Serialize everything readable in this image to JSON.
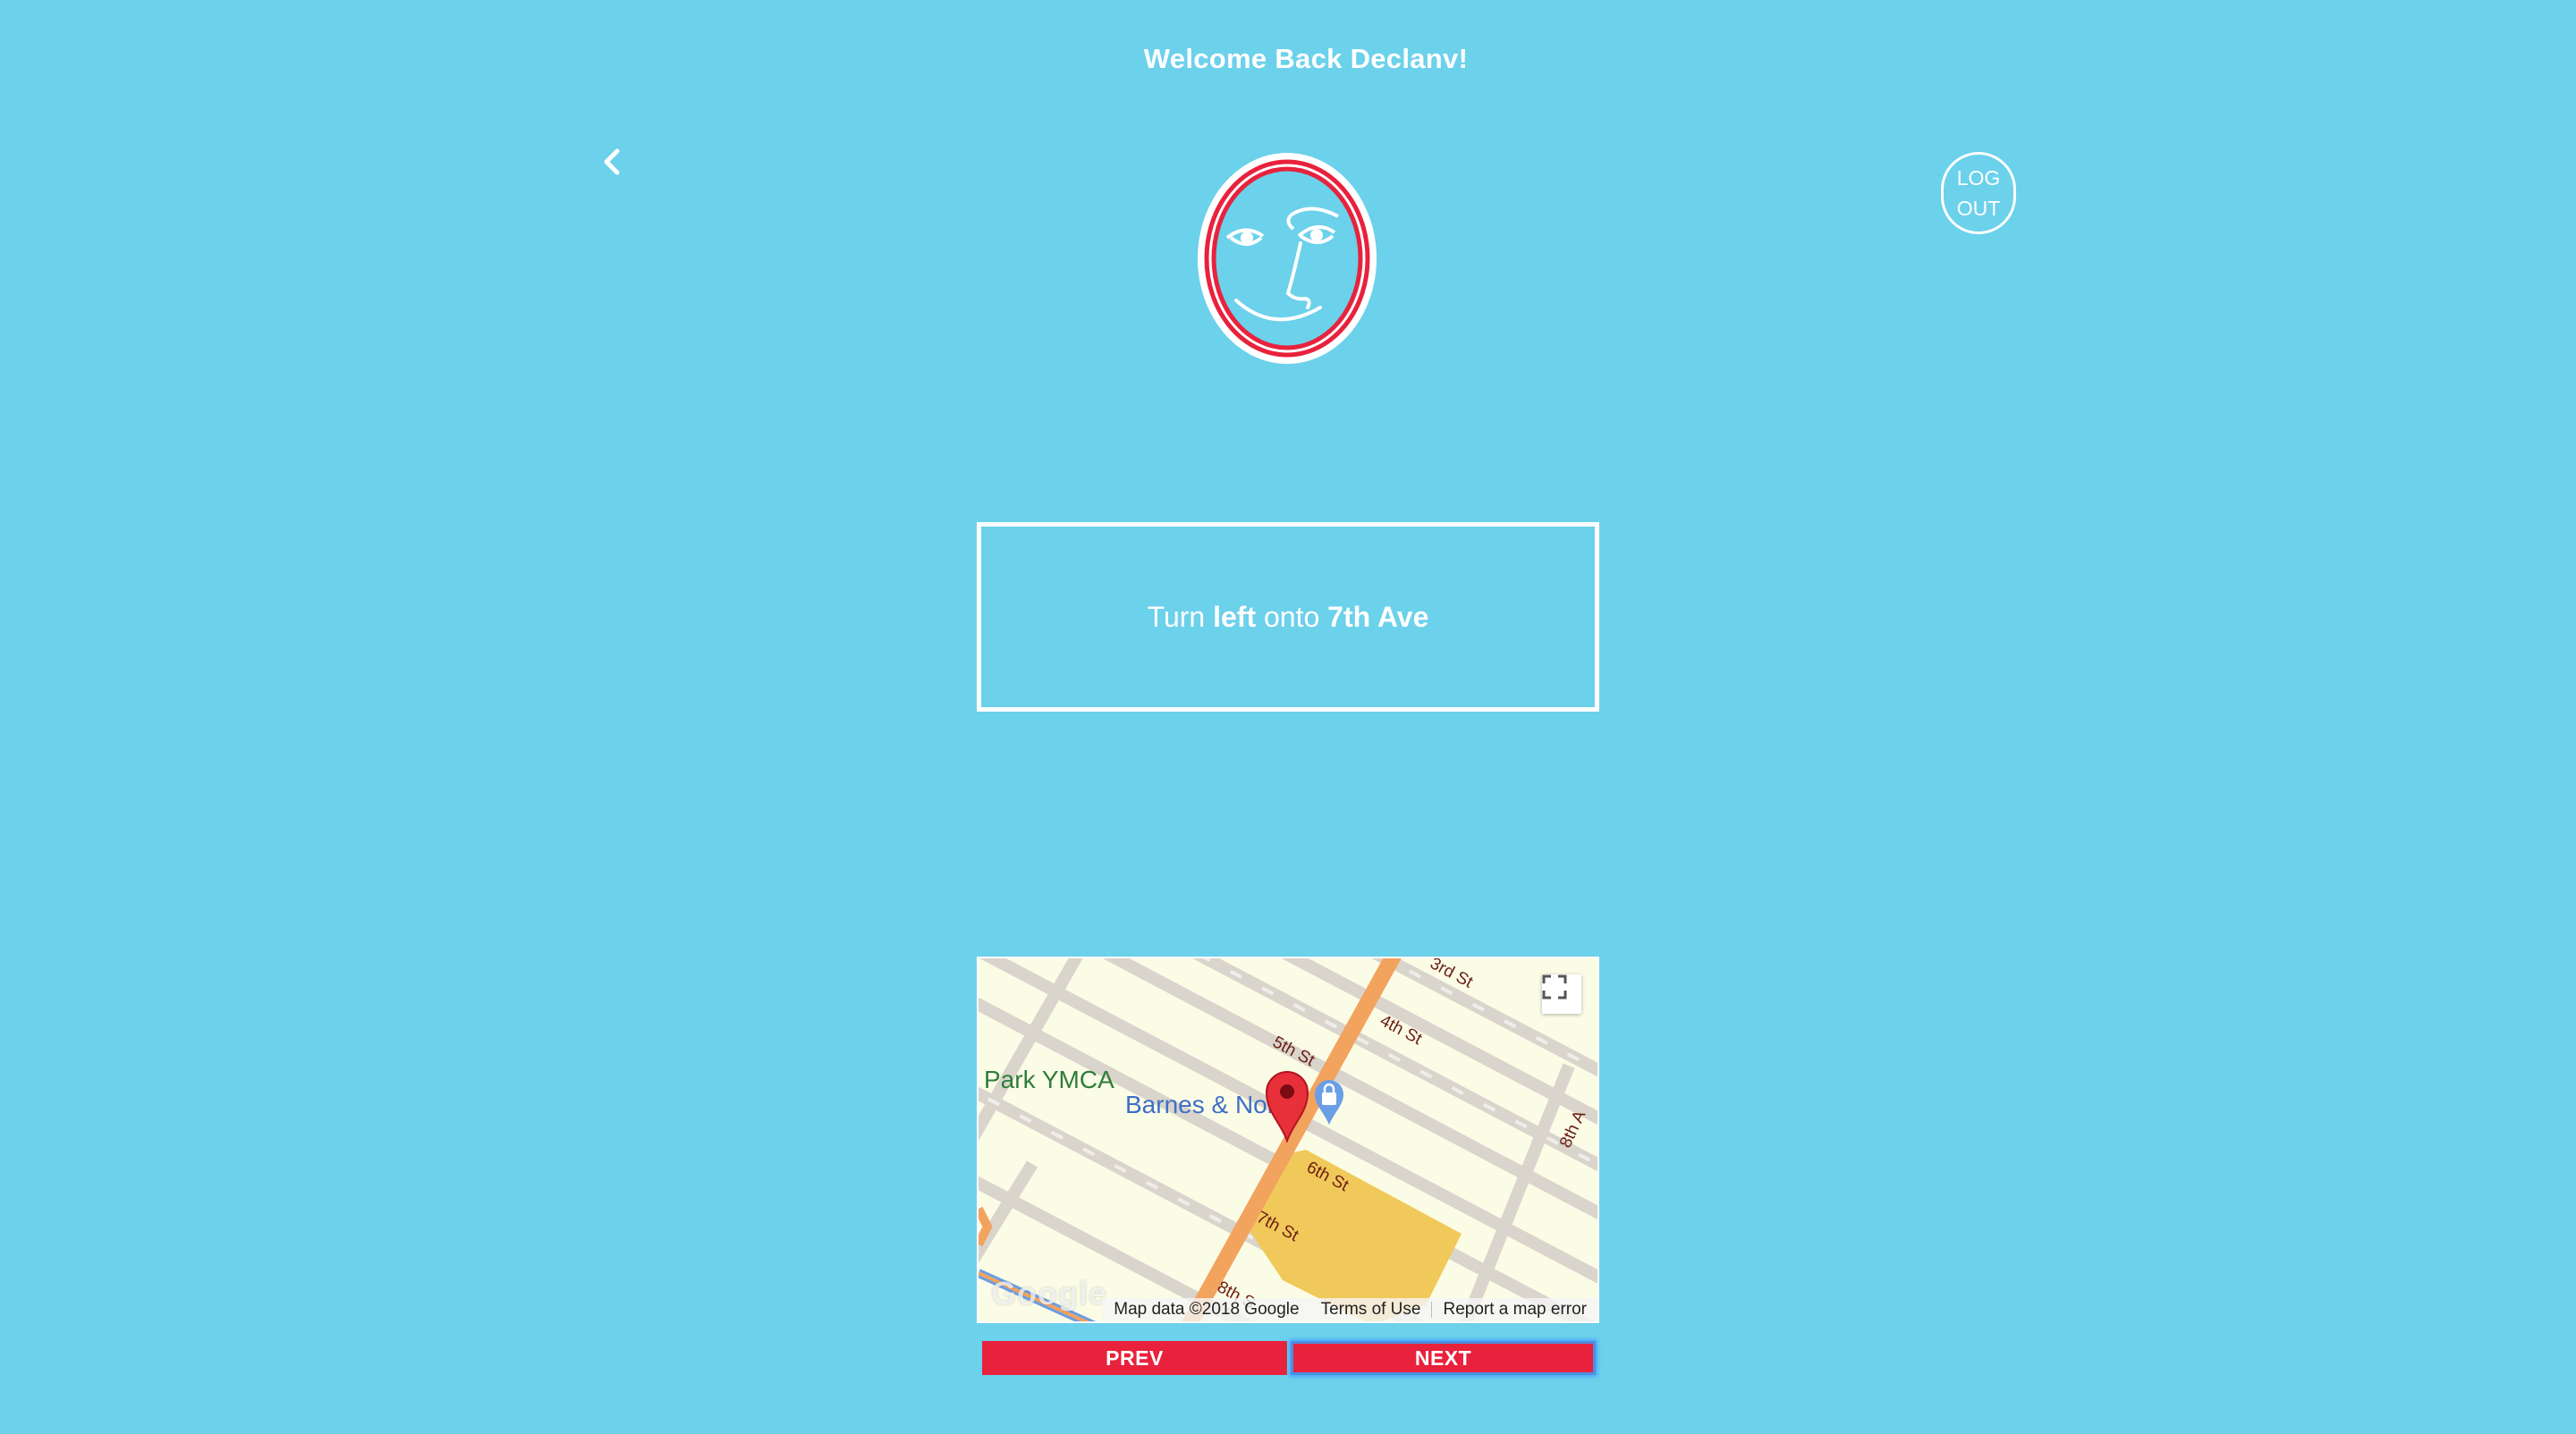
{
  "header": {
    "welcome_text": "Welcome Back Declanv!"
  },
  "nav": {
    "back_icon": "chevron-left-icon",
    "logout_line1": "LOG",
    "logout_line2": "OUT"
  },
  "logo": {
    "icon": "face-logo-icon",
    "colors": {
      "face": "#6cd1eb",
      "ring": "#e8223c",
      "outline": "#ffffff"
    }
  },
  "instruction": {
    "prefix": "Turn",
    "direction": "left",
    "connector": "onto",
    "street": "7th Ave"
  },
  "map": {
    "poi": {
      "ymca": "Park YMCA",
      "bookstore": "Barnes & Nob"
    },
    "streets": {
      "st3": "3rd St",
      "st4": "4th St",
      "st5": "5th St",
      "st6": "6th St",
      "st7": "7th St",
      "st8": "8th S",
      "ave8": "8th A"
    },
    "logo_text": "Google",
    "attribution": {
      "data": "Map data ©2018 Google",
      "terms": "Terms of Use",
      "report": "Report a map error"
    },
    "fullscreen_icon": "fullscreen-icon",
    "marker_icon": "map-pin-icon",
    "shopping_icon": "shopping-bag-icon"
  },
  "controls": {
    "prev_label": "PREV",
    "next_label": "NEXT"
  },
  "colors": {
    "background": "#6cd1eb",
    "accent": "#e8223c",
    "focus": "#4a90e2"
  }
}
